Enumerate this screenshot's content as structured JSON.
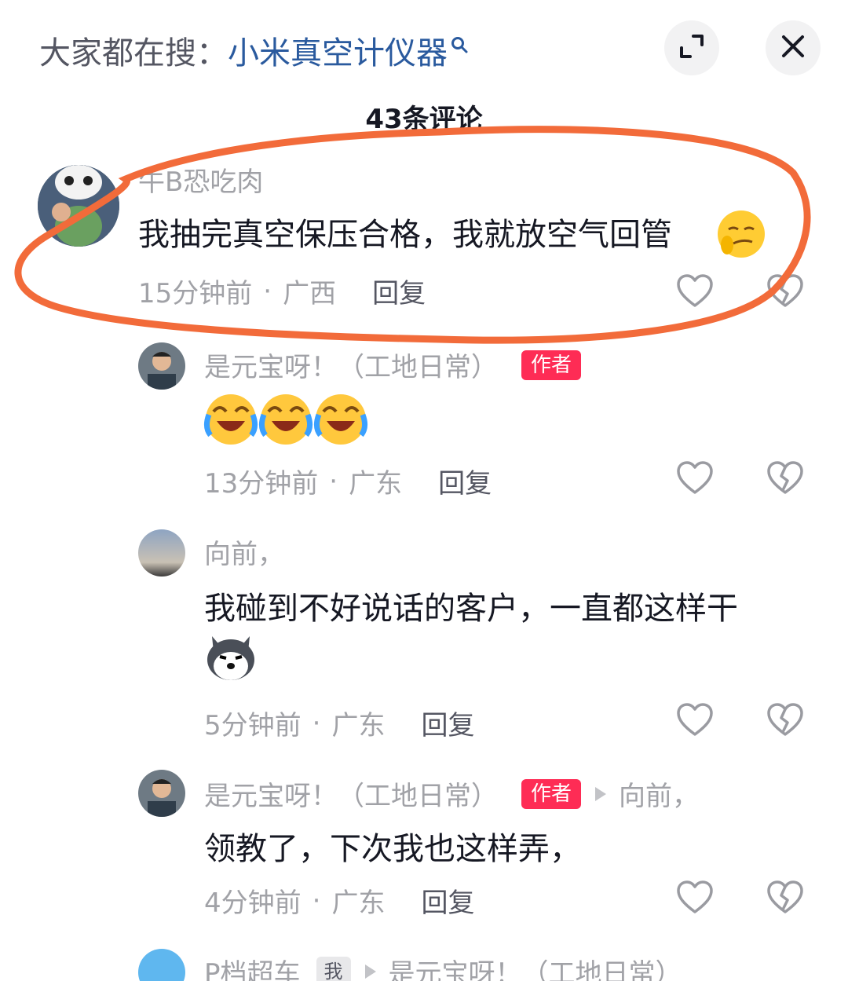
{
  "header": {
    "search_prefix": "大家都在搜：",
    "search_query": "小米真空计仪器"
  },
  "comments_count": "43条评论",
  "comments": [
    {
      "username": "牛B恐吃肉",
      "text": "我抽完真空保压合格，我就放空气回管",
      "time": "15分钟前",
      "dot": "·",
      "location": "广西",
      "reply": "回复"
    },
    {
      "username": "是元宝呀！（工地日常）",
      "badge": "作者",
      "time": "13分钟前",
      "dot": "·",
      "location": "广东",
      "reply": "回复"
    },
    {
      "username": "向前，",
      "text": "我碰到不好说话的客户，一直都这样干",
      "time": "5分钟前",
      "dot": "·",
      "location": "广东",
      "reply": "回复"
    },
    {
      "username": "是元宝呀！（工地日常）",
      "badge": "作者",
      "reply_to": "向前，",
      "text": "领教了，下次我也这样弄，",
      "time": "4分钟前",
      "dot": "·",
      "location": "广东",
      "reply": "回复"
    },
    {
      "username": "P档超车",
      "badge": "我",
      "reply_to": "是元宝呀！（工地日常）"
    }
  ],
  "annotation_color": "#f26b3a"
}
